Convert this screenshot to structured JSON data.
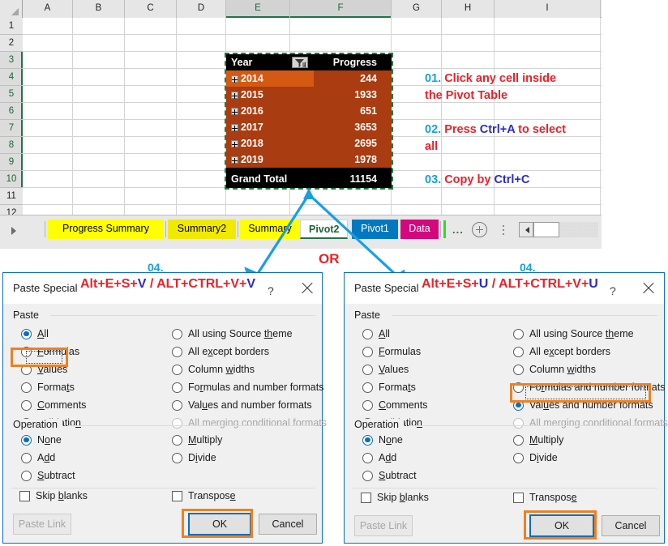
{
  "spreadsheet": {
    "column_headers": [
      "A",
      "B",
      "C",
      "D",
      "E",
      "F",
      "G",
      "H",
      "I"
    ],
    "selected_columns": [
      "E",
      "F"
    ],
    "row_headers": [
      "1",
      "2",
      "3",
      "4",
      "5",
      "6",
      "7",
      "8",
      "9",
      "10",
      "11",
      "12"
    ],
    "selected_rows": [
      "3",
      "4",
      "5",
      "6",
      "7",
      "8",
      "9",
      "10"
    ]
  },
  "pivot_table": {
    "header": {
      "year": "Year",
      "progress": "Progress",
      "filter_icon": "filter-icon"
    },
    "rows": [
      {
        "year": "2014",
        "progress": "244",
        "active": true
      },
      {
        "year": "2015",
        "progress": "1933",
        "active": false
      },
      {
        "year": "2016",
        "progress": "651",
        "active": false
      },
      {
        "year": "2017",
        "progress": "3653",
        "active": false
      },
      {
        "year": "2018",
        "progress": "2695",
        "active": false
      },
      {
        "year": "2019",
        "progress": "1978",
        "active": false
      }
    ],
    "grand_total": {
      "label": "Grand Total",
      "value": "11154"
    },
    "colors": {
      "header_bg": "#000000",
      "body_bg": "#a93c10",
      "active_cell_bg": "#d45a13",
      "marquee": "#1f7a3f"
    }
  },
  "instructions": [
    {
      "num": "01",
      "dot": ".",
      "line1_a": " Click any cell inside",
      "line2": "the Pivot Table"
    },
    {
      "num": "02",
      "dot": ".",
      "pre": " Press ",
      "key": "Ctrl+A",
      "post": " to select",
      "line2": "all"
    },
    {
      "num": "03",
      "dot": ".",
      "pre": " Copy by ",
      "key": "Ctrl+C",
      "post": ""
    }
  ],
  "tab_bar": {
    "nav_icon": "nav-right-icon",
    "tabs": [
      {
        "label": "Progress Summary",
        "style": "yellow",
        "active": false
      },
      {
        "label": "Summary2",
        "style": "yellow2",
        "active": false
      },
      {
        "label": "Summary",
        "style": "yellow",
        "active": false
      },
      {
        "label": "Pivot2",
        "style": "active",
        "active": true
      },
      {
        "label": "Pivot1",
        "style": "blue",
        "active": false
      },
      {
        "label": "Data",
        "style": "pink",
        "active": false
      }
    ],
    "more_label": "...",
    "new_sheet_icon": "plus-circle-icon",
    "grip_icon": "vertical-dots-icon",
    "scroll_icon": "scroll-left-icon"
  },
  "or_label": "OR",
  "dialog_left": {
    "step": "04.",
    "title": "Paste Special",
    "shortcut": {
      "a": "Alt+E+S+",
      "a_key": "V",
      "sep": " / ",
      "b": "ALT+CTRL+V+",
      "b_key": "V"
    },
    "help_label": "?",
    "close_icon": "close-icon",
    "paste_group": "Paste",
    "paste_left": [
      {
        "pre": "",
        "u": "A",
        "post": "ll",
        "checked": false,
        "dim": false
      },
      {
        "pre": "",
        "u": "F",
        "post": "ormulas",
        "checked": false,
        "dim": false
      },
      {
        "pre": "",
        "u": "V",
        "post": "alues",
        "checked": true,
        "dim": false
      },
      {
        "pre": "Forma",
        "u": "t",
        "post": "s",
        "checked": false,
        "dim": false
      },
      {
        "pre": "",
        "u": "C",
        "post": "omments",
        "checked": false,
        "dim": false
      },
      {
        "pre": "Validatio",
        "u": "n",
        "post": "",
        "checked": false,
        "dim": false
      }
    ],
    "paste_right": [
      {
        "pre": "All using Source ",
        "u": "th",
        "post": "eme",
        "checked": false,
        "dim": false
      },
      {
        "pre": "All e",
        "u": "x",
        "post": "cept borders",
        "checked": false,
        "dim": false
      },
      {
        "pre": "Column ",
        "u": "w",
        "post": "idths",
        "checked": false,
        "dim": false
      },
      {
        "pre": "Fo",
        "u": "r",
        "post": "mulas and number formats",
        "checked": false,
        "dim": false
      },
      {
        "pre": "Val",
        "u": "u",
        "post": "es and number formats",
        "checked": false,
        "dim": false
      },
      {
        "pre": "All merging conditional formats",
        "u": "",
        "post": "",
        "checked": false,
        "dim": true
      }
    ],
    "operation_group": "Operation",
    "operation_left": [
      {
        "pre": "N",
        "u": "o",
        "post": "ne",
        "checked": true,
        "dim": false
      },
      {
        "pre": "A",
        "u": "d",
        "post": "d",
        "checked": false,
        "dim": false
      },
      {
        "pre": "",
        "u": "S",
        "post": "ubtract",
        "checked": false,
        "dim": false
      }
    ],
    "operation_right": [
      {
        "pre": "",
        "u": "M",
        "post": "ultiply",
        "checked": false,
        "dim": false
      },
      {
        "pre": "D",
        "u": "i",
        "post": "vide",
        "checked": false,
        "dim": false
      }
    ],
    "skip_blanks": {
      "pre": "Skip ",
      "u": "b",
      "post": "lanks"
    },
    "transpose": {
      "pre": "Transpos",
      "u": "e",
      "post": ""
    },
    "paste_link": "Paste Link",
    "ok": "OK",
    "cancel": "Cancel",
    "highlighted_option": "Values"
  },
  "dialog_right": {
    "step": "04.",
    "title": "Paste Special",
    "shortcut": {
      "a": "Alt+E+S+",
      "a_key": "U",
      "sep": " / ",
      "b": "ALT+CTRL+V+",
      "b_key": "U"
    },
    "help_label": "?",
    "close_icon": "close-icon",
    "paste_group": "Paste",
    "paste_left": [
      {
        "pre": "",
        "u": "A",
        "post": "ll",
        "checked": false,
        "dim": false
      },
      {
        "pre": "",
        "u": "F",
        "post": "ormulas",
        "checked": false,
        "dim": false
      },
      {
        "pre": "",
        "u": "V",
        "post": "alues",
        "checked": false,
        "dim": false
      },
      {
        "pre": "Forma",
        "u": "t",
        "post": "s",
        "checked": false,
        "dim": false
      },
      {
        "pre": "",
        "u": "C",
        "post": "omments",
        "checked": false,
        "dim": false
      },
      {
        "pre": "Validatio",
        "u": "n",
        "post": "",
        "checked": false,
        "dim": false
      }
    ],
    "paste_right": [
      {
        "pre": "All using Source ",
        "u": "th",
        "post": "eme",
        "checked": false,
        "dim": false
      },
      {
        "pre": "All e",
        "u": "x",
        "post": "cept borders",
        "checked": false,
        "dim": false
      },
      {
        "pre": "Column ",
        "u": "w",
        "post": "idths",
        "checked": false,
        "dim": false
      },
      {
        "pre": "Fo",
        "u": "r",
        "post": "mulas and number formats",
        "checked": false,
        "dim": false
      },
      {
        "pre": "Val",
        "u": "u",
        "post": "es and number formats",
        "checked": true,
        "dim": false
      },
      {
        "pre": "All merging conditional formats",
        "u": "",
        "post": "",
        "checked": false,
        "dim": true
      }
    ],
    "operation_group": "Operation",
    "operation_left": [
      {
        "pre": "N",
        "u": "o",
        "post": "ne",
        "checked": true,
        "dim": false
      },
      {
        "pre": "A",
        "u": "d",
        "post": "d",
        "checked": false,
        "dim": false
      },
      {
        "pre": "",
        "u": "S",
        "post": "ubtract",
        "checked": false,
        "dim": false
      }
    ],
    "operation_right": [
      {
        "pre": "",
        "u": "M",
        "post": "ultiply",
        "checked": false,
        "dim": false
      },
      {
        "pre": "D",
        "u": "i",
        "post": "vide",
        "checked": false,
        "dim": false
      }
    ],
    "skip_blanks": {
      "pre": "Skip ",
      "u": "b",
      "post": "lanks"
    },
    "transpose": {
      "pre": "Transpos",
      "u": "e",
      "post": ""
    },
    "paste_link": "Paste Link",
    "ok": "OK",
    "cancel": "Cancel",
    "highlighted_option": "Values and number formats"
  },
  "colors": {
    "accent_blue": "#17a0e0",
    "red": "#e8232a",
    "key_blue": "#2a2ad0",
    "orange_highlight": "#ef8022",
    "dialog_border": "#0a6ebd",
    "excel_green": "#217346"
  }
}
